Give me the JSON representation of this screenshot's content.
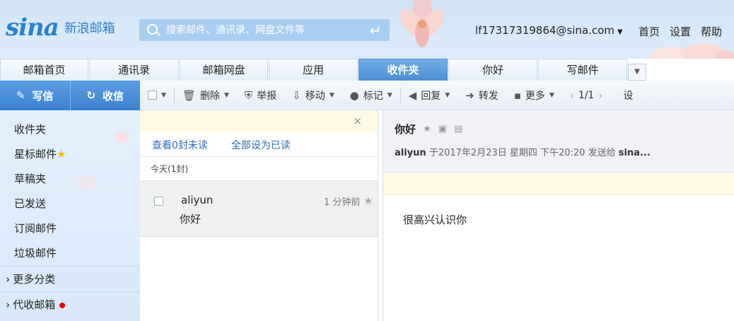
{
  "header": {
    "logo_text": "sina",
    "logo_sub": "新浪邮箱",
    "search_placeholder": "搜索邮件、通讯录、网盘文件等",
    "account": "lf17317319864@sina.com",
    "links": [
      "首页",
      "设置",
      "帮助"
    ]
  },
  "tabs": [
    {
      "label": "邮箱首页",
      "w": 125
    },
    {
      "label": "通讯录",
      "w": 127
    },
    {
      "label": "邮箱网盘",
      "w": 125
    },
    {
      "label": "应用",
      "w": 126
    },
    {
      "label": "收件夹",
      "w": 126,
      "active": true
    },
    {
      "label": "你好",
      "w": 126
    },
    {
      "label": "写邮件",
      "w": 126
    }
  ],
  "left_actions": {
    "compose": "写信",
    "receive": "收信"
  },
  "toolbar": {
    "delete": "删除",
    "report": "举报",
    "move": "移动",
    "mark": "标记",
    "reply": "回复",
    "forward": "转发",
    "more": "更多",
    "pager": "1/1",
    "settings_partial": "设"
  },
  "sidebar": {
    "items": [
      "收件夹",
      "星标邮件",
      "草稿夹",
      "已发送",
      "订阅邮件",
      "垃圾邮件"
    ],
    "groups": [
      "更多分类",
      "代收邮箱"
    ]
  },
  "list": {
    "unread_link": "查看0封未读",
    "mark_all_link": "全部设为已读",
    "today_label": "今天(1封)",
    "messages": [
      {
        "from": "aliyun",
        "subject": "你好",
        "time": "1 分钟前"
      }
    ]
  },
  "reading": {
    "subject": "你好",
    "sender": "aliyun",
    "meta": "于2017年2月23日 星期四 下午20:20 发送给",
    "recipient": "sina...",
    "body": "很高兴认识你"
  },
  "colors": {
    "accent": "#4b8fd5",
    "header_bg": "#d9eafa",
    "link": "#2d6bb8"
  }
}
